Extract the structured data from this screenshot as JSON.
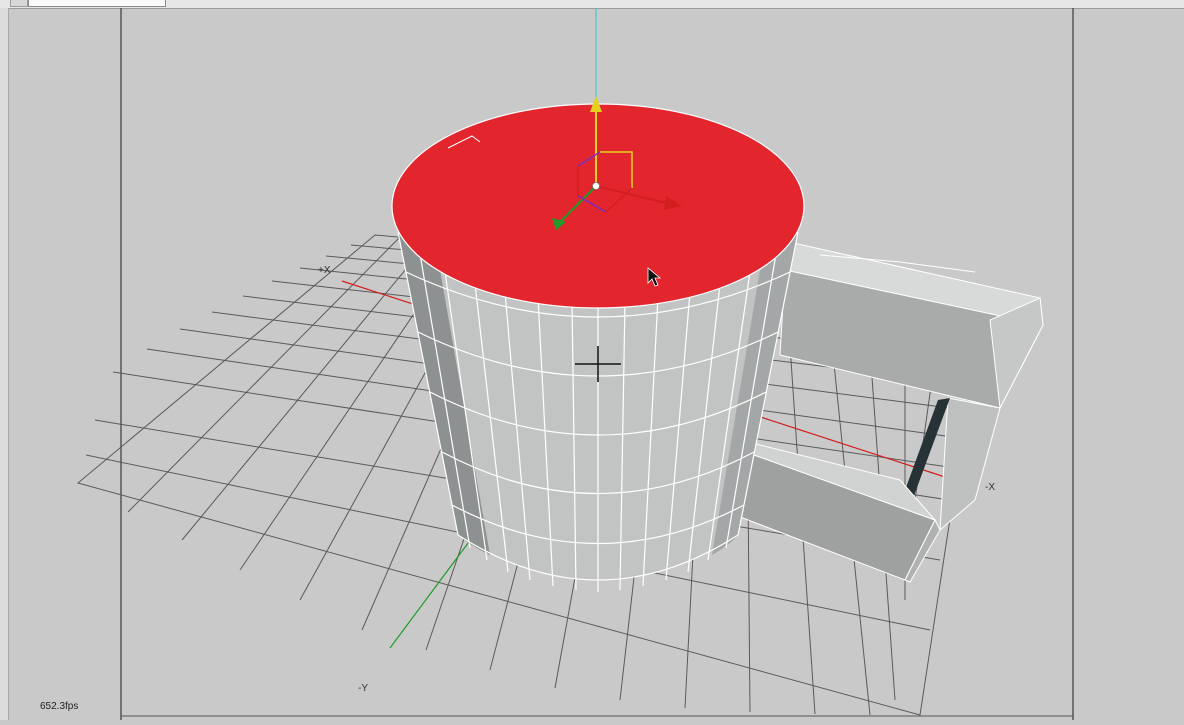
{
  "viewport": {
    "fps_readout": "652.3fps",
    "axis_labels": {
      "plus_x": "+X",
      "minus_x": "-X",
      "minus_y": "-Y"
    }
  },
  "scene": {
    "object": "mug",
    "selected_face": "top cap",
    "colors": {
      "background": "#c9c9c9",
      "grid_line": "#5a5a5a",
      "selected_face": "#e3262d",
      "mesh_face": "#c2c4c4",
      "mesh_edge": "#ffffff",
      "x_axis": "#d21e1e",
      "y_axis": "#1f9b2a",
      "z_axis": "#46c8c8",
      "gizmo_y": "#e3d21e",
      "gizmo_purple": "#7a2cc4"
    }
  }
}
